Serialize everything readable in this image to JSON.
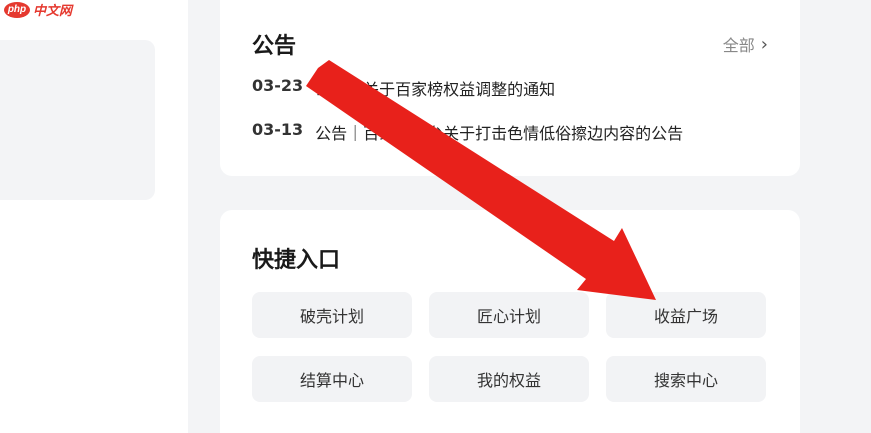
{
  "watermark": {
    "logo": "php",
    "text": "中文网"
  },
  "notice": {
    "title": "公告",
    "see_all": "全部",
    "items": [
      {
        "date": "03-23",
        "text": "公告｜关于百家榜权益调整的通知"
      },
      {
        "date": "03-13",
        "text": "公告｜百家号平台关于打击色情低俗擦边内容的公告"
      }
    ]
  },
  "quick": {
    "title": "快捷入口",
    "buttons": [
      {
        "label": "破壳计划"
      },
      {
        "label": "匠心计划"
      },
      {
        "label": "收益广场"
      },
      {
        "label": "结算中心"
      },
      {
        "label": "我的权益"
      },
      {
        "label": "搜索中心"
      }
    ]
  },
  "arrow_color": "#e8211b"
}
